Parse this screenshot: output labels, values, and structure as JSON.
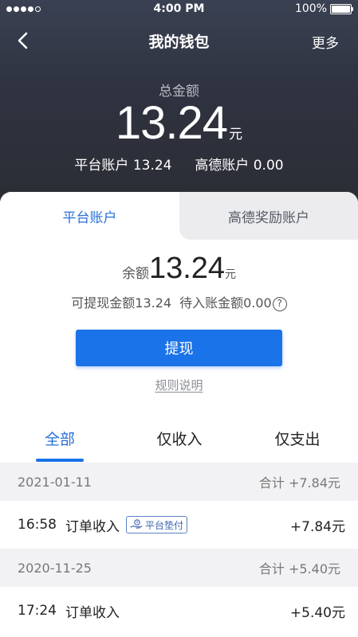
{
  "status_bar": {
    "time": "4:00 PM",
    "battery": "100%"
  },
  "nav": {
    "title": "我的钱包",
    "more_label": "更多"
  },
  "summary": {
    "total_label": "总金额",
    "total_amount": "13.24",
    "total_unit": "元",
    "platform_label": "平台账户",
    "platform_amount": "13.24",
    "gaode_label": "高德账户",
    "gaode_amount": "0.00"
  },
  "account_tabs": [
    {
      "label": "平台账户",
      "active": true
    },
    {
      "label": "高德奖励账户",
      "active": false
    }
  ],
  "balance": {
    "label": "余额",
    "amount": "13.24",
    "unit": "元",
    "withdrawable_label": "可提现金额",
    "withdrawable_amount": "13.24",
    "pending_label": "待入账金额",
    "pending_amount": "0.00",
    "help_glyph": "?"
  },
  "actions": {
    "withdraw_label": "提现",
    "rules_label": "规则说明"
  },
  "filter_tabs": [
    {
      "label": "全部",
      "active": true
    },
    {
      "label": "仅收入",
      "active": false
    },
    {
      "label": "仅支出",
      "active": false
    }
  ],
  "records": [
    {
      "date": "2021-01-11",
      "total": "合计 +7.84元",
      "items": [
        {
          "time": "16:58",
          "type": "订单收入",
          "badge": "平台垫付",
          "amount": "+7.84元"
        }
      ]
    },
    {
      "date": "2020-11-25",
      "total": "合计 +5.40元",
      "items": [
        {
          "time": "17:24",
          "type": "订单收入",
          "amount": "+5.40元"
        }
      ]
    }
  ],
  "icons": {
    "back": "chevron-left-icon",
    "help": "question-circle-icon",
    "badge": "hand-coin-icon"
  },
  "colors": {
    "accent": "#1a73e8",
    "header_bg": "#2f3340",
    "tab_active": "#2a6fd6"
  }
}
